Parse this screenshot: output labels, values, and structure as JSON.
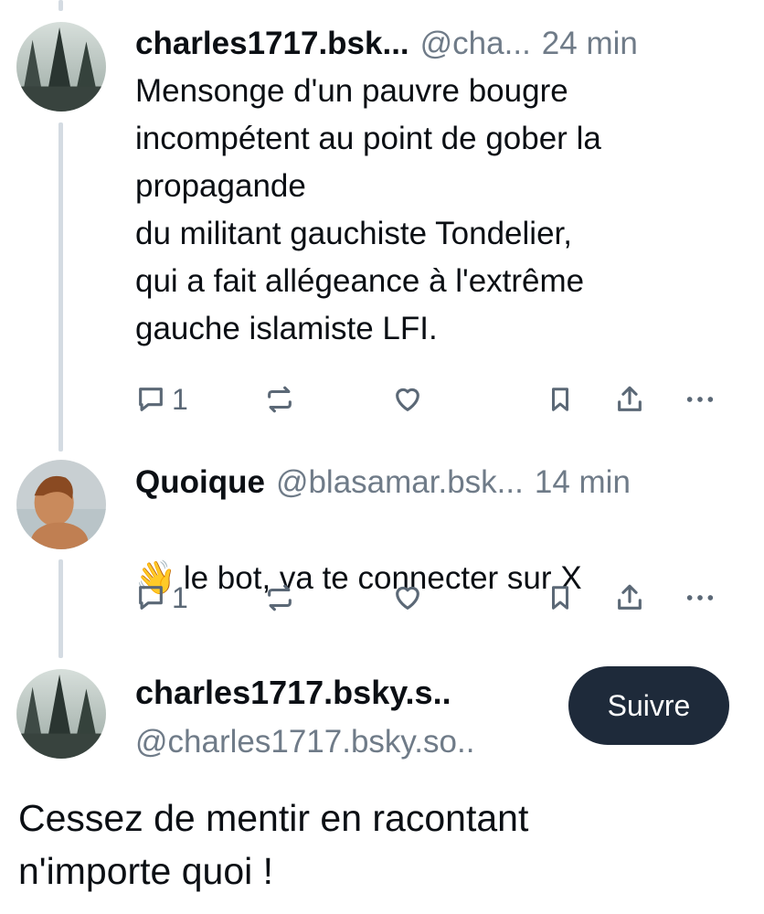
{
  "posts": [
    {
      "name": "charles1717.bsk...",
      "handle": "@cha...",
      "time": "24 min",
      "text": "Mensonge d'un pauvre bougre\nincompétent au point de gober la\npropagande\ndu militant gauchiste Tondelier,\nqui a fait allégeance à l'extrême\ngauche islamiste LFI.",
      "reply_count": "1",
      "avatar_icon": "forest-avatar"
    },
    {
      "name": "Quoique",
      "handle": "@blasamar.bsk...",
      "time": "14 min",
      "emoji": "👋",
      "text": "le bot,  va te connecter sur X",
      "reply_count": "1",
      "avatar_icon": "child-avatar"
    }
  ],
  "focused_post": {
    "name": "charles1717.bsky.s..",
    "handle": "@charles1717.bsky.so..",
    "follow_label": "Suivre",
    "text": "Cessez de mentir en racontant\nn'importe quoi !"
  },
  "icons": {
    "reply": "reply-icon",
    "repost": "repost-icon",
    "like": "heart-icon",
    "bookmark": "bookmark-icon",
    "share": "share-icon",
    "more": "more-icon"
  },
  "colors": {
    "thread_line": "#d4dbe2",
    "muted": "#6f7b88",
    "button": "#1e2a3a"
  }
}
